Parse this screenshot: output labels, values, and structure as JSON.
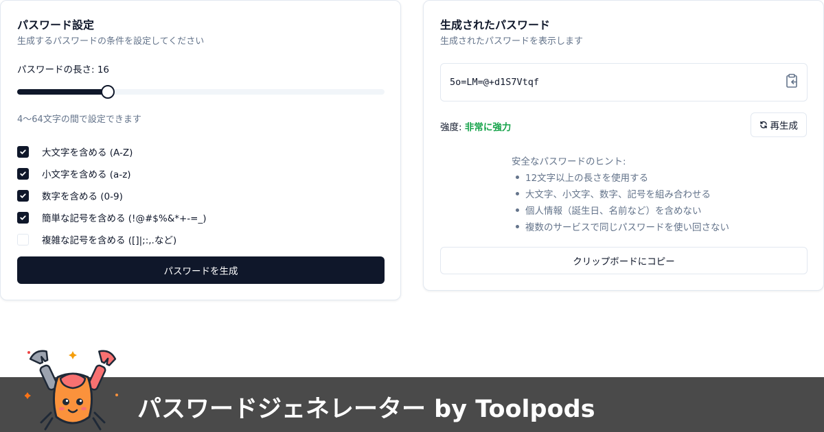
{
  "settings": {
    "title": "パスワード設定",
    "subtitle": "生成するパスワードの条件を設定してください",
    "length_label": "パスワードの長さ: 16",
    "length_value": 16,
    "length_min": 4,
    "length_max": 64,
    "range_hint": "4〜64文字の間で設定できます",
    "options": [
      {
        "label": "大文字を含める (A-Z)",
        "checked": true
      },
      {
        "label": "小文字を含める (a-z)",
        "checked": true
      },
      {
        "label": "数字を含める (0-9)",
        "checked": true
      },
      {
        "label": "簡単な記号を含める (!@#$%&*+-=_)",
        "checked": true
      },
      {
        "label": "複雑な記号を含める ([]|;:,.など)",
        "checked": false
      }
    ],
    "generate_button": "パスワードを生成"
  },
  "result": {
    "title": "生成されたパスワード",
    "subtitle": "生成されたパスワードを表示します",
    "password": "5o=LM=@+d1S7Vtqf",
    "copy_icon": "clipboard-copy-icon",
    "strength_label": "強度: ",
    "strength_value": "非常に強力",
    "strength_color": "#16a34a",
    "regenerate_button": "再生成",
    "regenerate_icon": "refresh-icon",
    "tips_title": "安全なパスワードのヒント:",
    "tips": [
      "12文字以上の長さを使用する",
      "大文字、小文字、数字、記号を組み合わせる",
      "個人情報（誕生日、名前など）を含めない",
      "複数のサービスで同じパスワードを使い回さない"
    ],
    "copy_button": "クリップボードにコピー"
  },
  "banner": {
    "title": "パスワードジェネレーター by Toolpods",
    "mascot": "crab-mascot"
  },
  "colors": {
    "primary": "#0f172a",
    "muted": "#64748b",
    "border": "#e2e8f0",
    "banner_bg": "#4a4a4a"
  }
}
